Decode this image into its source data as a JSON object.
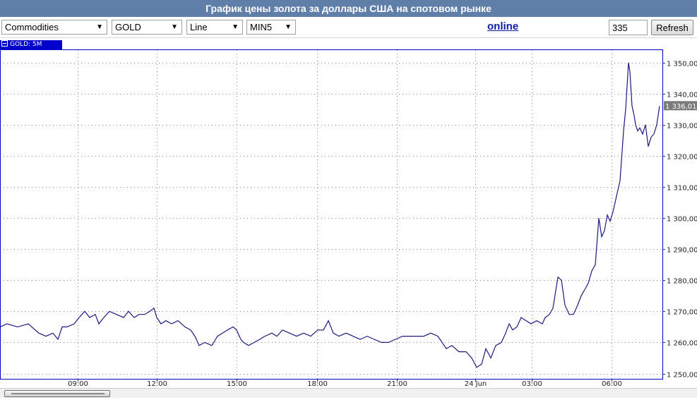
{
  "window": {
    "title": "График цены золота за доллары США на спотовом рынке"
  },
  "toolbar": {
    "market": "Commodities",
    "instrument": "GOLD",
    "chart_type": "Line",
    "interval": "MIN5",
    "online_label": "online",
    "bars_value": "335",
    "refresh_label": "Refresh"
  },
  "legend": {
    "label": "GOLD: 5M"
  },
  "colors": {
    "title_bg": "#5f7fa8",
    "series": "#1a1a80",
    "legend_bg": "#0000cc",
    "price_tag": "#7a7a7a"
  },
  "chart_data": {
    "type": "line",
    "series": [
      {
        "name": "GOLD: 5M",
        "points": [
          [
            0,
            1265
          ],
          [
            10,
            1266
          ],
          [
            25,
            1265
          ],
          [
            40,
            1266
          ],
          [
            55,
            1263
          ],
          [
            65,
            1262
          ],
          [
            75,
            1263
          ],
          [
            82,
            1261
          ],
          [
            88,
            1265
          ],
          [
            95,
            1265
          ],
          [
            105,
            1266
          ],
          [
            112,
            1268
          ],
          [
            120,
            1270
          ],
          [
            127,
            1268
          ],
          [
            135,
            1269
          ],
          [
            140,
            1266
          ],
          [
            147,
            1268
          ],
          [
            155,
            1270
          ],
          [
            165,
            1269
          ],
          [
            175,
            1268
          ],
          [
            182,
            1270
          ],
          [
            190,
            1268
          ],
          [
            197,
            1269
          ],
          [
            205,
            1269
          ],
          [
            212,
            1270
          ],
          [
            218,
            1271
          ],
          [
            222,
            1268
          ],
          [
            228,
            1266
          ],
          [
            235,
            1267
          ],
          [
            243,
            1266
          ],
          [
            252,
            1267
          ],
          [
            262,
            1265
          ],
          [
            270,
            1264
          ],
          [
            276,
            1262
          ],
          [
            282,
            1259
          ],
          [
            290,
            1260
          ],
          [
            300,
            1259
          ],
          [
            308,
            1262
          ],
          [
            315,
            1263
          ],
          [
            322,
            1264
          ],
          [
            330,
            1265
          ],
          [
            335,
            1264
          ],
          [
            341,
            1261
          ],
          [
            345,
            1260
          ],
          [
            352,
            1259
          ],
          [
            360,
            1260
          ],
          [
            368,
            1261
          ],
          [
            375,
            1262
          ],
          [
            385,
            1263
          ],
          [
            392,
            1262
          ],
          [
            400,
            1264
          ],
          [
            410,
            1263
          ],
          [
            420,
            1262
          ],
          [
            430,
            1263
          ],
          [
            440,
            1262
          ],
          [
            450,
            1264
          ],
          [
            458,
            1264
          ],
          [
            465,
            1267
          ],
          [
            472,
            1263
          ],
          [
            480,
            1262
          ],
          [
            490,
            1263
          ],
          [
            500,
            1262
          ],
          [
            510,
            1261
          ],
          [
            520,
            1262
          ],
          [
            530,
            1261
          ],
          [
            540,
            1260
          ],
          [
            550,
            1260
          ],
          [
            560,
            1261
          ],
          [
            570,
            1262
          ],
          [
            580,
            1262
          ],
          [
            590,
            1262
          ],
          [
            600,
            1262
          ],
          [
            610,
            1263
          ],
          [
            620,
            1262
          ],
          [
            626,
            1260
          ],
          [
            632,
            1258
          ],
          [
            640,
            1259
          ],
          [
            650,
            1257
          ],
          [
            660,
            1257
          ],
          [
            668,
            1255
          ],
          [
            675,
            1252
          ],
          [
            682,
            1253
          ],
          [
            688,
            1258
          ],
          [
            695,
            1255
          ],
          [
            702,
            1259
          ],
          [
            710,
            1260
          ],
          [
            716,
            1263
          ],
          [
            721,
            1266
          ],
          [
            726,
            1264
          ],
          [
            732,
            1265
          ],
          [
            738,
            1268
          ],
          [
            745,
            1267
          ],
          [
            752,
            1266
          ],
          [
            760,
            1267
          ],
          [
            768,
            1266
          ],
          [
            772,
            1268
          ],
          [
            778,
            1269
          ],
          [
            783,
            1271
          ],
          [
            790,
            1281
          ],
          [
            795,
            1280
          ],
          [
            800,
            1272
          ],
          [
            806,
            1269
          ],
          [
            812,
            1269
          ],
          [
            818,
            1272
          ],
          [
            823,
            1275
          ],
          [
            828,
            1277
          ],
          [
            833,
            1279
          ],
          [
            838,
            1283
          ],
          [
            843,
            1285
          ],
          [
            848,
            1300
          ],
          [
            852,
            1294
          ],
          [
            856,
            1296
          ],
          [
            860,
            1301
          ],
          [
            864,
            1299
          ],
          [
            868,
            1302
          ],
          [
            873,
            1307
          ],
          [
            878,
            1312
          ],
          [
            883,
            1328
          ],
          [
            886,
            1335
          ],
          [
            890,
            1350
          ],
          [
            892,
            1347
          ],
          [
            895,
            1336
          ],
          [
            898,
            1333
          ],
          [
            900,
            1330
          ],
          [
            903,
            1328
          ],
          [
            906,
            1329
          ],
          [
            910,
            1327
          ],
          [
            914,
            1330
          ],
          [
            918,
            1323
          ],
          [
            922,
            1326
          ],
          [
            926,
            1327
          ],
          [
            930,
            1330
          ],
          [
            934,
            1336
          ]
        ]
      }
    ],
    "x_ticks": [
      "09:00",
      "12:00",
      "15:00",
      "18:00",
      "21:00",
      "24 Jun",
      "03:00",
      "06:00"
    ],
    "y_ticks": [
      "1 250,00",
      "1 260,00",
      "1 270,00",
      "1 280,00",
      "1 290,00",
      "1 300,00",
      "1 310,00",
      "1 320,00",
      "1 330,00",
      "1 340,00",
      "1 350,00"
    ],
    "y_tick_values": [
      1250,
      1260,
      1270,
      1280,
      1290,
      1300,
      1310,
      1320,
      1330,
      1340,
      1350
    ],
    "ylim": [
      1248.3,
      1354
    ],
    "last_price": "1 336,01",
    "grid": true,
    "axis_position": "right"
  }
}
